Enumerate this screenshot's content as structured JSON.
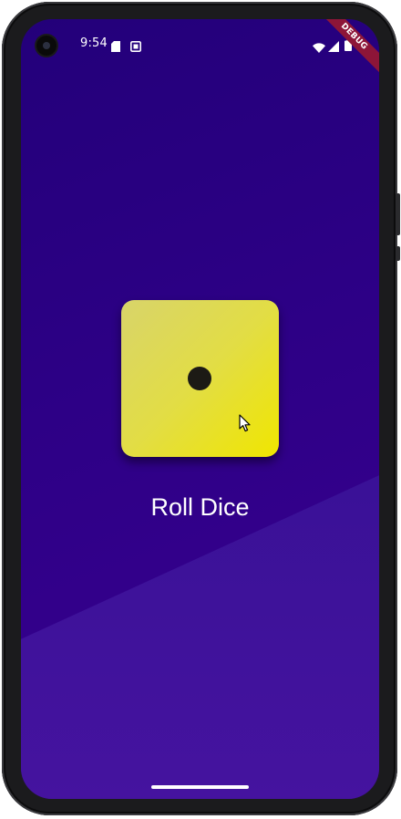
{
  "status_bar": {
    "time": "9:54",
    "icons": [
      "sd-card-icon",
      "screenshot-icon",
      "wifi-icon",
      "cell-signal-icon",
      "battery-icon"
    ]
  },
  "debug_banner": {
    "label": "DEBUG"
  },
  "dice": {
    "face_value": 1,
    "colors": {
      "light": "#d8d46a",
      "dark": "#f0e600",
      "pip": "#1c1a15"
    }
  },
  "roll_button": {
    "label": "Roll Dice"
  },
  "theme": {
    "background_top": "#23007a",
    "background_bottom": "#45139f",
    "banner": "#8d1538"
  }
}
